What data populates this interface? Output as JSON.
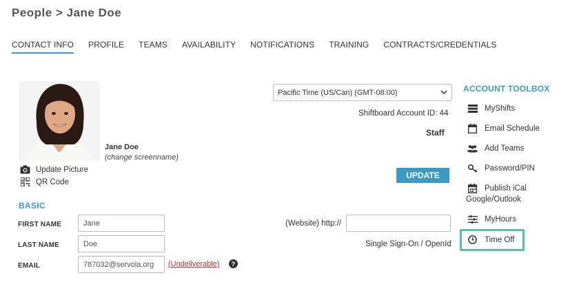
{
  "header": {
    "title": "People > Jane Doe"
  },
  "tabs": [
    {
      "label": "CONTACT INFO",
      "active": true
    },
    {
      "label": "PROFILE"
    },
    {
      "label": "TEAMS"
    },
    {
      "label": "AVAILABILITY"
    },
    {
      "label": "NOTIFICATIONS"
    },
    {
      "label": "TRAINING"
    },
    {
      "label": "CONTRACTS/CREDENTIALS"
    }
  ],
  "profile": {
    "name": "Jane Doe",
    "change_screenname": "(change screenname)",
    "update_picture": "Update Picture",
    "qr_code": "QR Code"
  },
  "settings": {
    "timezone": "Pacific Time (US/Can) (GMT-08:00)",
    "account_id_label": "Shiftboard Account ID: 44",
    "role": "Staff",
    "update_label": "UPDATE"
  },
  "basic": {
    "section_title": "BASIC",
    "first_name_label": "FIRST NAME",
    "first_name_value": "Jane",
    "last_name_label": "LAST NAME",
    "last_name_value": "Doe",
    "email_label": "EMAIL",
    "email_value": "787032@servola.org",
    "undeliverable": "(Undeliverable)",
    "website_label": "(Website) http://",
    "website_value": "",
    "sso_label": "Single Sign-On / OpenId"
  },
  "toolbox": {
    "title": "ACCOUNT TOOLBOX",
    "items": [
      {
        "label": "MyShifts",
        "icon": "list-icon"
      },
      {
        "label": "Email Schedule",
        "icon": "calendar-icon"
      },
      {
        "label": "Add Teams",
        "icon": "users-icon"
      },
      {
        "label": "Password/PIN",
        "icon": "key-icon"
      },
      {
        "label": "Publish iCal",
        "label2": "Google/Outlook",
        "icon": "calendar-grid-icon"
      },
      {
        "label": "MyHours",
        "icon": "sliders-icon"
      },
      {
        "label": "Time Off",
        "icon": "clock-icon"
      }
    ]
  },
  "colors": {
    "accent": "#3a9ac4",
    "highlight": "#55c2a0",
    "error": "#d12a2a"
  }
}
